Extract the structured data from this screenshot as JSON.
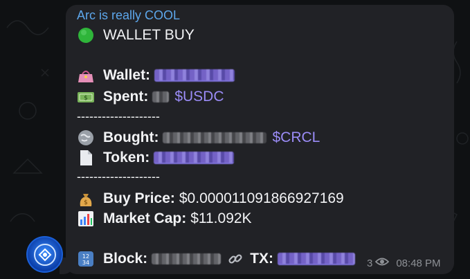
{
  "message": {
    "sender": "Arc is really COOL",
    "title": "WALLET BUY",
    "wallet_label": "Wallet:",
    "spent_label": "Spent:",
    "spent_token": "$USDC",
    "separator": "--------------------",
    "bought_label": "Bought:",
    "bought_token": "$CRCL",
    "token_label": "Token:",
    "buy_price_label": "Buy Price:",
    "buy_price_value": "$0.000011091866927169",
    "market_cap_label": "Market Cap:",
    "market_cap_value": "$11.092K",
    "block_label": "Block:",
    "tx_label": "TX:",
    "block_icon_text": "12\n34"
  },
  "meta": {
    "views": "3",
    "time": "08:48 PM"
  },
  "colors": {
    "bubble": "#212226",
    "sender": "#5da7ec",
    "ticker": "#9b8cf7",
    "meta": "#8e9196"
  },
  "icons": {
    "title": "green-circle-icon",
    "wallet": "purse-icon",
    "spent": "dollar-banknote-icon",
    "bought": "globe-icon",
    "token": "document-icon",
    "buy_price": "money-bag-icon",
    "market_cap": "chart-increasing-icon",
    "block": "numbers-input-icon",
    "link": "link-icon",
    "views": "eye-icon"
  }
}
